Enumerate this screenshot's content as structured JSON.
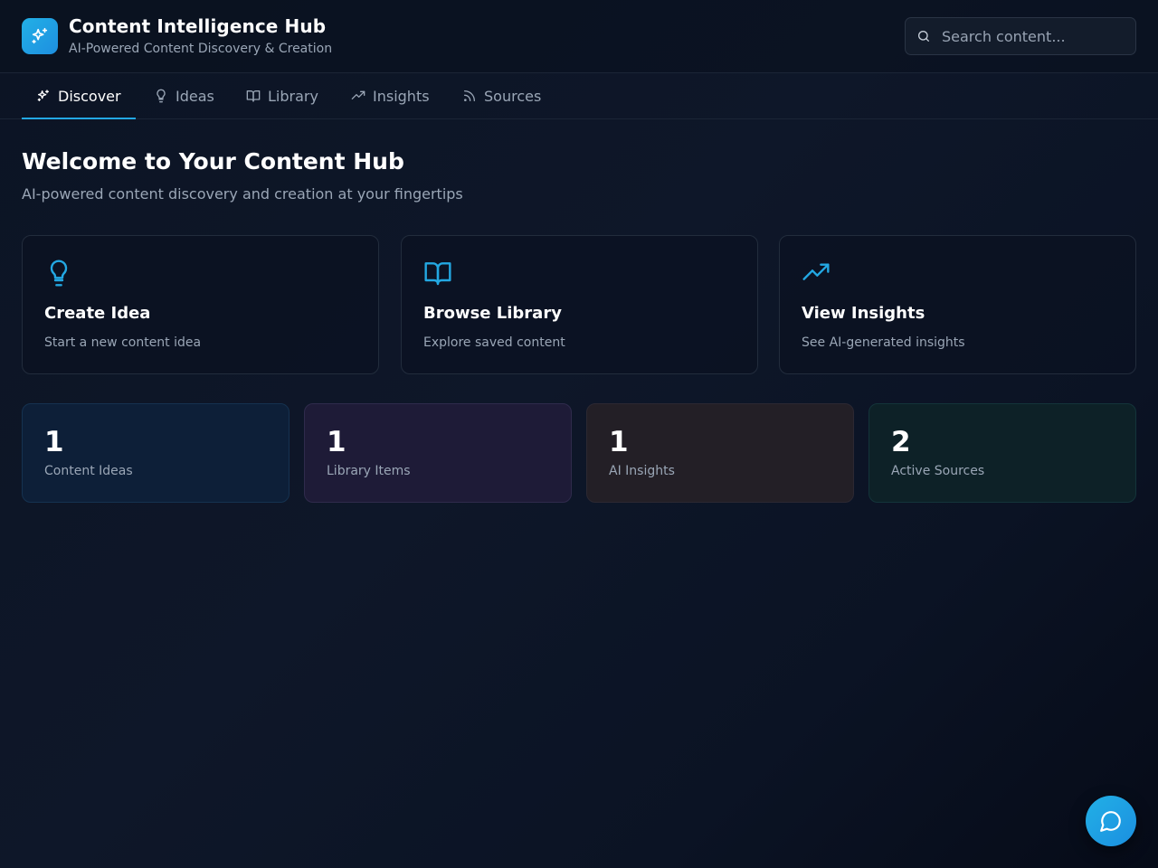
{
  "app": {
    "title": "Content Intelligence Hub",
    "subtitle": "AI-Powered Content Discovery & Creation",
    "logo_icon": "sparkles-icon"
  },
  "search": {
    "placeholder": "Search content...",
    "value": "",
    "icon": "search-icon"
  },
  "tabs": [
    {
      "label": "Discover",
      "icon": "sparkles-icon",
      "active": true
    },
    {
      "label": "Ideas",
      "icon": "lightbulb-icon",
      "active": false
    },
    {
      "label": "Library",
      "icon": "book-open-icon",
      "active": false
    },
    {
      "label": "Insights",
      "icon": "trending-up-icon",
      "active": false
    },
    {
      "label": "Sources",
      "icon": "rss-icon",
      "active": false
    }
  ],
  "welcome": {
    "title": "Welcome to Your Content Hub",
    "subtitle": "AI-powered content discovery and creation at your fingertips"
  },
  "actions": [
    {
      "title": "Create Idea",
      "description": "Start a new content idea",
      "icon": "lightbulb-icon"
    },
    {
      "title": "Browse Library",
      "description": "Explore saved content",
      "icon": "book-open-icon"
    },
    {
      "title": "View Insights",
      "description": "See AI-generated insights",
      "icon": "trending-up-icon"
    }
  ],
  "stats": [
    {
      "value": "1",
      "label": "Content Ideas"
    },
    {
      "value": "1",
      "label": "Library Items"
    },
    {
      "value": "1",
      "label": "AI Insights"
    },
    {
      "value": "2",
      "label": "Active Sources"
    }
  ],
  "chat": {
    "icon": "message-circle-icon"
  },
  "colors": {
    "accent": "#23a8e3",
    "background": "#0c1424",
    "text_muted": "#9aa6b6"
  }
}
